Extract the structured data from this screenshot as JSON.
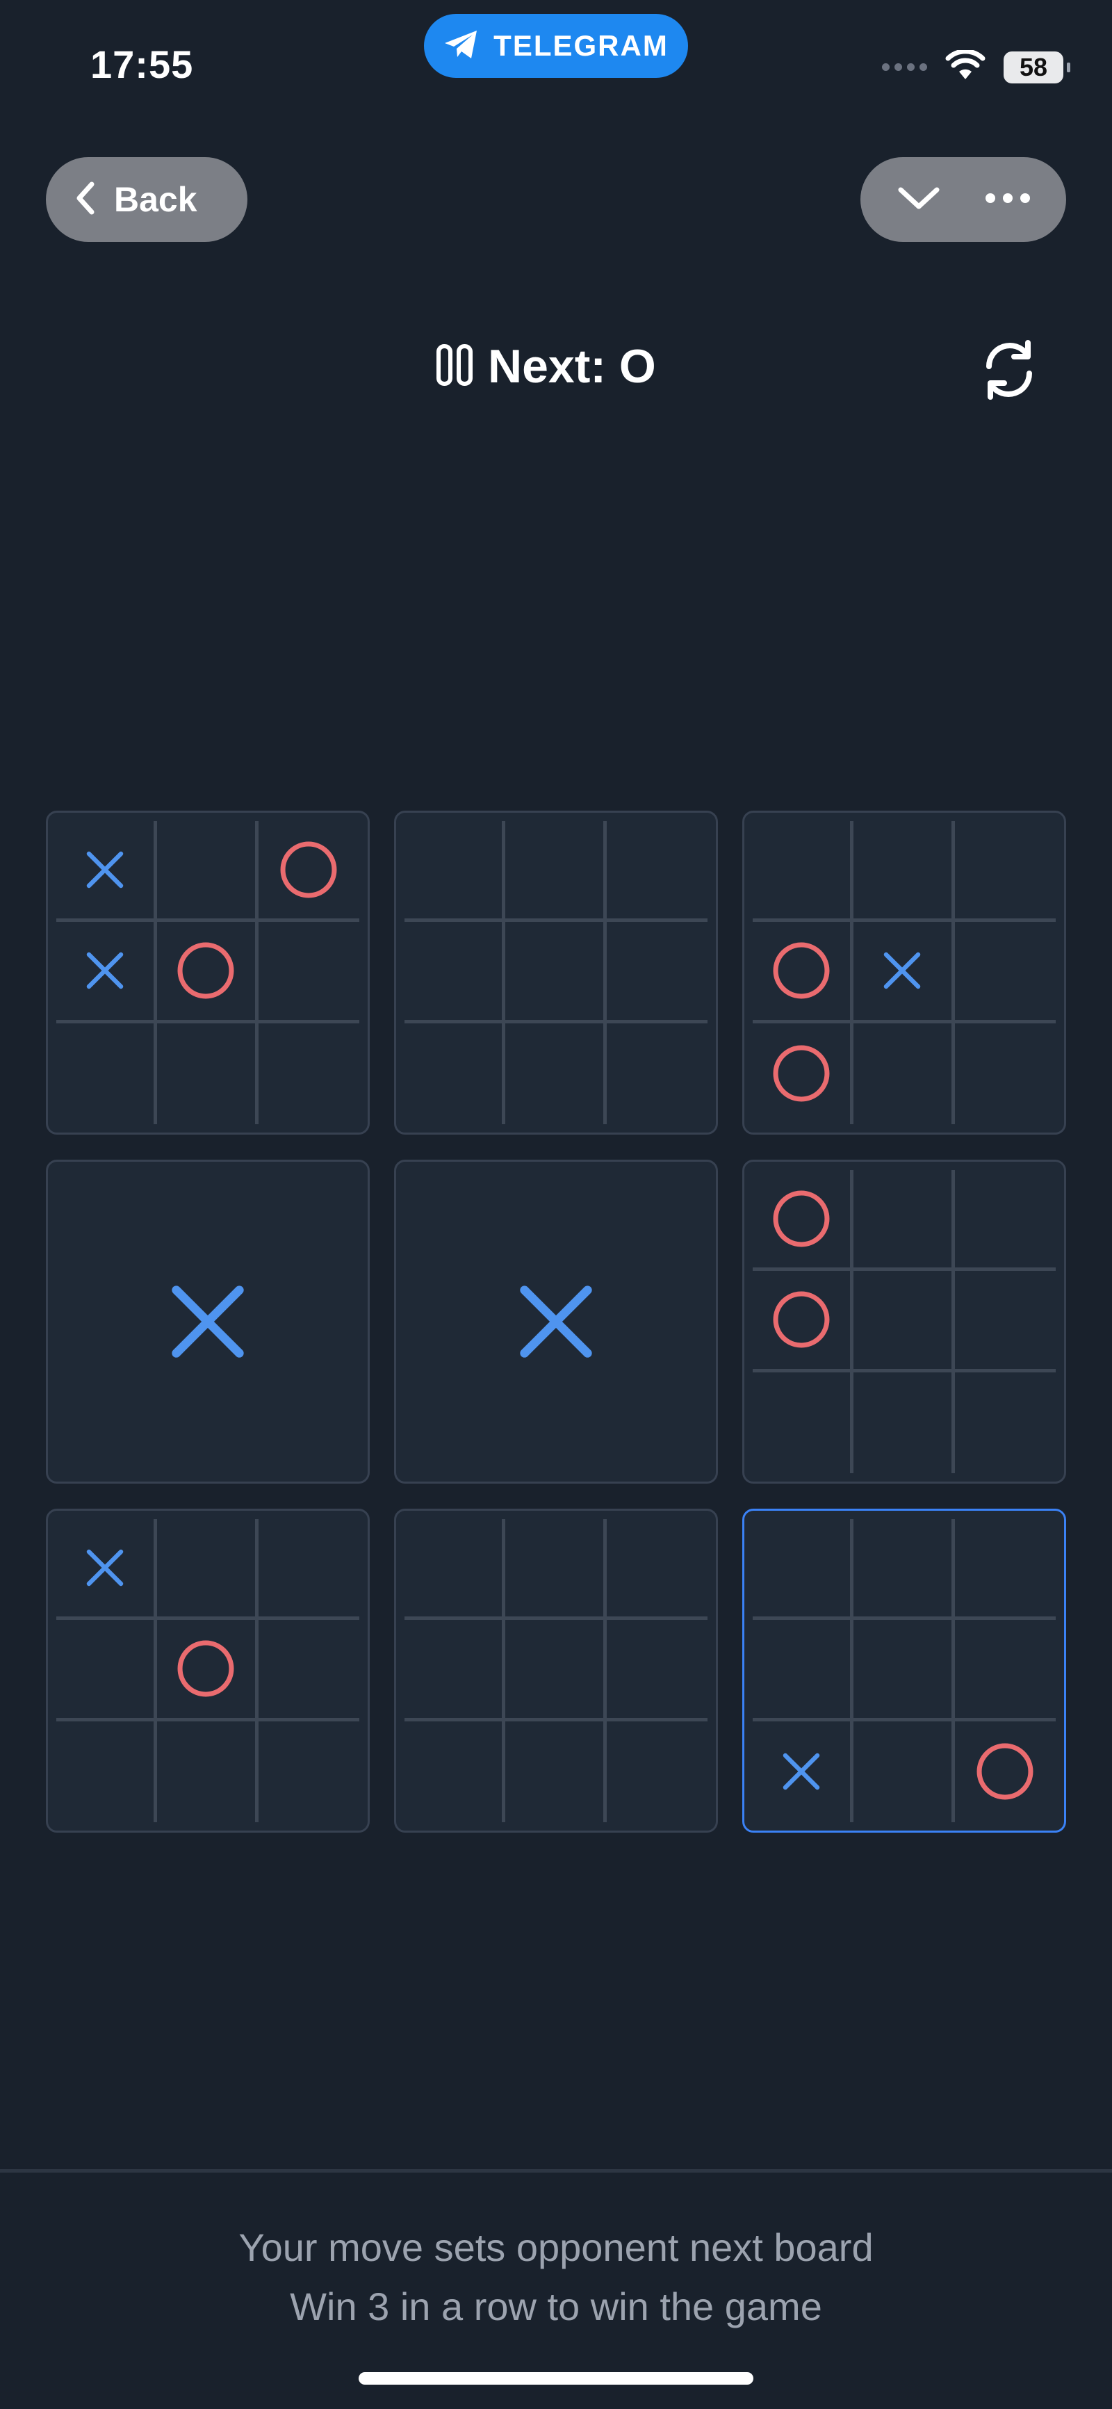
{
  "status_bar": {
    "time": "17:55",
    "app_pill": "TELEGRAM",
    "battery": "58"
  },
  "nav": {
    "back_label": "Back",
    "collapse_icon": "chevron-down-icon",
    "more_icon": "more-dots-icon"
  },
  "game": {
    "status_text": "Next: O",
    "status_icon": "pause-icon",
    "restart_icon": "restart-icon",
    "active_board_index": 8,
    "boards": [
      {
        "winner": null,
        "cells": [
          "X",
          "",
          "O",
          "X",
          "O",
          "",
          "",
          "",
          ""
        ]
      },
      {
        "winner": null,
        "cells": [
          "",
          "",
          "",
          "",
          "",
          "",
          "",
          "",
          ""
        ]
      },
      {
        "winner": null,
        "cells": [
          "",
          "",
          "",
          "O",
          "X",
          "",
          "O",
          "",
          ""
        ]
      },
      {
        "winner": "X",
        "cells": [
          "",
          "",
          "",
          "",
          "",
          "",
          "",
          "",
          ""
        ]
      },
      {
        "winner": "X",
        "cells": [
          "",
          "",
          "",
          "",
          "",
          "",
          "",
          "",
          ""
        ]
      },
      {
        "winner": null,
        "cells": [
          "O",
          "",
          "",
          "O",
          "",
          "",
          "",
          "",
          ""
        ]
      },
      {
        "winner": null,
        "cells": [
          "X",
          "",
          "",
          "",
          "O",
          "",
          "",
          "",
          ""
        ]
      },
      {
        "winner": null,
        "cells": [
          "",
          "",
          "",
          "",
          "",
          "",
          "",
          "",
          ""
        ]
      },
      {
        "winner": null,
        "cells": [
          "",
          "",
          "",
          "",
          "",
          "",
          "X",
          "",
          "O"
        ]
      }
    ]
  },
  "footer": {
    "hint_1": "Your move sets opponent next board",
    "hint_2": "Win 3 in a row to win the game"
  },
  "colors": {
    "background": "#19212c",
    "x_color": "#4f94ef",
    "o_color": "#ea6b6f",
    "active_border": "#3b82f6",
    "telegram_blue": "#1e88f0"
  }
}
